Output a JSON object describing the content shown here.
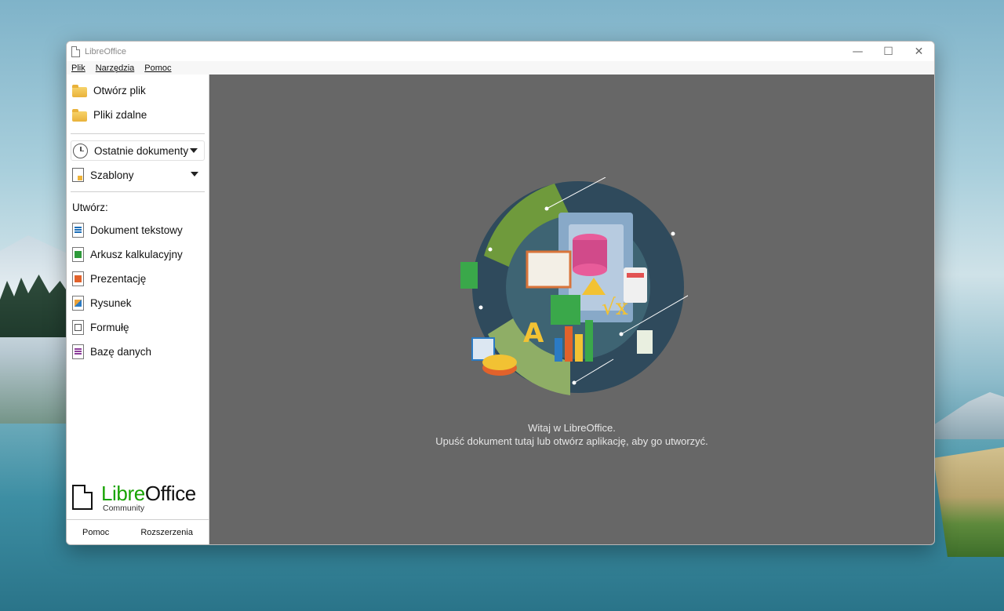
{
  "window": {
    "title": "LibreOffice",
    "controls": {
      "minimize": "—",
      "maximize": "☐",
      "close": "✕"
    }
  },
  "menubar": [
    "Plik",
    "Narzędzia",
    "Pomoc"
  ],
  "sidebar": {
    "open_file": "Otwórz plik",
    "remote_files": "Pliki zdalne",
    "recent_documents": "Ostatnie dokumenty",
    "templates": "Szablony",
    "create_heading": "Utwórz:",
    "create_items": [
      {
        "label": "Dokument tekstowy",
        "icon": "writer-icon"
      },
      {
        "label": "Arkusz kalkulacyjny",
        "icon": "calc-icon"
      },
      {
        "label": "Prezentację",
        "icon": "impress-icon"
      },
      {
        "label": "Rysunek",
        "icon": "draw-icon"
      },
      {
        "label": "Formułę",
        "icon": "math-icon"
      },
      {
        "label": "Bazę danych",
        "icon": "base-icon"
      }
    ],
    "logo": {
      "libre": "Libre",
      "office": "Office",
      "sub": "Community"
    },
    "bottom": {
      "help": "Pomoc",
      "extensions": "Rozszerzenia"
    }
  },
  "main": {
    "welcome_line1": "Witaj w LibreOffice.",
    "welcome_line2": "Upuść dokument tutaj lub otwórz aplikację, aby go utworzyć."
  },
  "colors": {
    "brand_green": "#18a303",
    "start_center_bg": "#676767"
  }
}
